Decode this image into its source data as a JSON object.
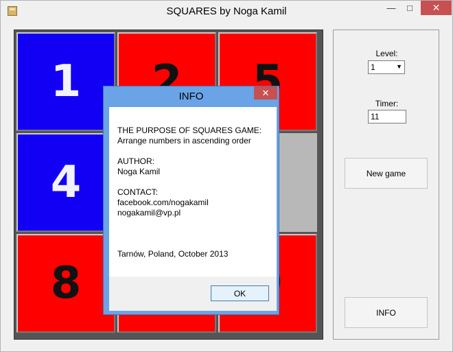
{
  "window": {
    "title": "SQUARES by Noga Kamil",
    "minimize_icon": "minimize-icon",
    "maximize_icon": "maximize-icon",
    "close_icon": "close-icon"
  },
  "board": {
    "cells": [
      {
        "label": "1",
        "color": "blue"
      },
      {
        "label": "2",
        "color": "red"
      },
      {
        "label": "5",
        "color": "red"
      },
      {
        "label": "4",
        "color": "blue"
      },
      {
        "label": "",
        "color": "red"
      },
      {
        "label": "",
        "color": "empty"
      },
      {
        "label": "8",
        "color": "red"
      },
      {
        "label": "",
        "color": "red"
      },
      {
        "label": "9",
        "color": "red"
      }
    ],
    "colors": {
      "blue": "#1200f5",
      "red": "#ff0000",
      "empty": "#b8b8b8"
    }
  },
  "panel": {
    "level_label": "Level:",
    "level_value": "1",
    "timer_label": "Timer:",
    "timer_value": "11",
    "new_game_label": "New game",
    "info_label": "INFO"
  },
  "dialog": {
    "title": "INFO",
    "close_label": "✕",
    "purpose_heading": "THE PURPOSE OF SQUARES GAME:",
    "purpose_text": "Arrange numbers in ascending order",
    "author_heading": "AUTHOR:",
    "author_name": "Noga Kamil",
    "contact_heading": "CONTACT:",
    "contact_facebook": "facebook.com/nogakamil",
    "contact_email": "nogakamil@vp.pl",
    "location_date": "Tarnów, Poland, October 2013",
    "ok_label": "OK"
  }
}
